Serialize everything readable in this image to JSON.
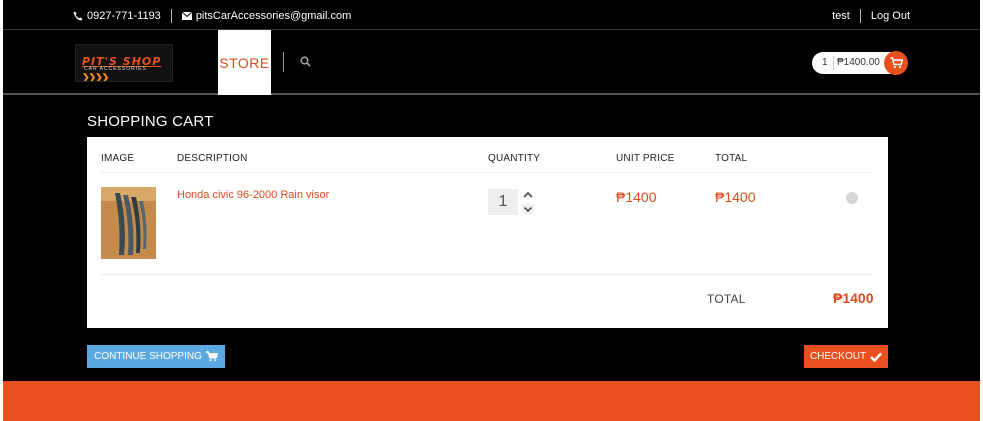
{
  "topbar": {
    "phone": "0927-771-1193",
    "email": "pitsCarAccessories@gmail.com",
    "user": "test",
    "logout": "Log Out"
  },
  "nav": {
    "logo_main": "PIT'S SHOP",
    "logo_sub": "CAR ACCESSORIES",
    "store_tab": "STORE",
    "cart_count": "1",
    "cart_amount": "₱1400.00"
  },
  "page": {
    "heading": "SHOPPING CART"
  },
  "cart": {
    "columns": {
      "image": "IMAGE",
      "description": "DESCRIPTION",
      "quantity": "QUANTITY",
      "unit_price": "UNIT PRICE",
      "total": "TOTAL"
    },
    "items": [
      {
        "description": "Honda civic 96-2000 Rain visor",
        "quantity": "1",
        "unit_price": "₱1400",
        "total": "₱1400"
      }
    ],
    "total_label": "TOTAL",
    "total_value": "₱1400"
  },
  "buttons": {
    "continue": "CONTINUE SHOPPING",
    "checkout": "CHECKOUT"
  },
  "colors": {
    "accent": "#e8511f",
    "link_blue": "#5ba9e0"
  }
}
